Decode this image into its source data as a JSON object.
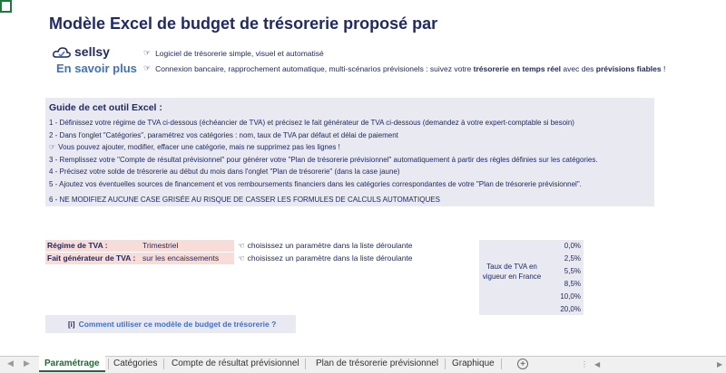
{
  "header": {
    "title": "Modèle Excel de budget de trésorerie proposé par",
    "logo_text": "sellsy",
    "learn_more": "En savoir plus",
    "bullet1": "Logiciel de trésorerie simple, visuel et automatisé",
    "bullet2_pre": "Connexion bancaire, rapprochement automatique, multi-scénarios prévisionels : suivez votre ",
    "bullet2_bold1": "trésorerie en temps réel",
    "bullet2_mid": " avec des ",
    "bullet2_bold2": "prévisions fiables",
    "bullet2_post": " !"
  },
  "guide": {
    "title": "Guide de cet outil Excel :",
    "lines": [
      "1 - Définissez votre régime de TVA ci-dessous (échéancier de TVA) et précisez le fait générateur de TVA ci-dessous (demandez à votre expert-comptable si besoin)",
      "2 - Dans l'onglet \"Catégories\", paramétrez vos catégories : nom, taux de TVA par défaut et délai de paiement",
      "Vous pouvez ajouter, modifier, effacer une catégorie, mais ne supprimez pas les lignes !",
      "3 - Remplissez votre \"Compte de résultat prévisionnel\" pour générer votre \"Plan de trésorerie prévisionnel\" automatiquement à partir des règles définies sur les catégories.",
      "4 - Précisez votre solde de trésorerie au début du mois dans l'onglet \"Plan de trésorerie\" (dans la case jaune)",
      "5 - Ajoutez vos éventuelles sources de financement et vos remboursements financiers dans les catégories correspondantes de votre \"Plan de trésorerie prévisionnel\".",
      "6 - NE MODIFIEZ AUCUNE CASE GRISÉE AU RISQUE DE CASSER LES FORMULES DE CALCULS AUTOMATIQUES"
    ]
  },
  "settings": {
    "regime_label": "Régime de TVA :",
    "regime_value": "Trimestriel",
    "fait_label": "Fait générateur de TVA :",
    "fait_value": "sur les encaissements",
    "hint": "choisissez un paramètre dans la liste déroulante"
  },
  "rates": {
    "label": "Taux de TVA en vigueur en France",
    "values": [
      "0,0%",
      "2,5%",
      "5,5%",
      "8,5%",
      "10,0%",
      "20,0%"
    ]
  },
  "howto": {
    "icon": "[i]",
    "text": "Comment utiliser ce modèle de budget de trésorerie ?"
  },
  "tabs": [
    "Paramétrage",
    "Catégories",
    "Compte de résultat prévisionnel",
    "Plan de trésorerie prévisionnel",
    "Graphique"
  ],
  "colors": {
    "accent": "#1f2a66",
    "link": "#3a6fd8",
    "excel_green": "#1d6b34",
    "input_bg": "#f8dcd8",
    "guide_bg": "#e8e9f1"
  }
}
